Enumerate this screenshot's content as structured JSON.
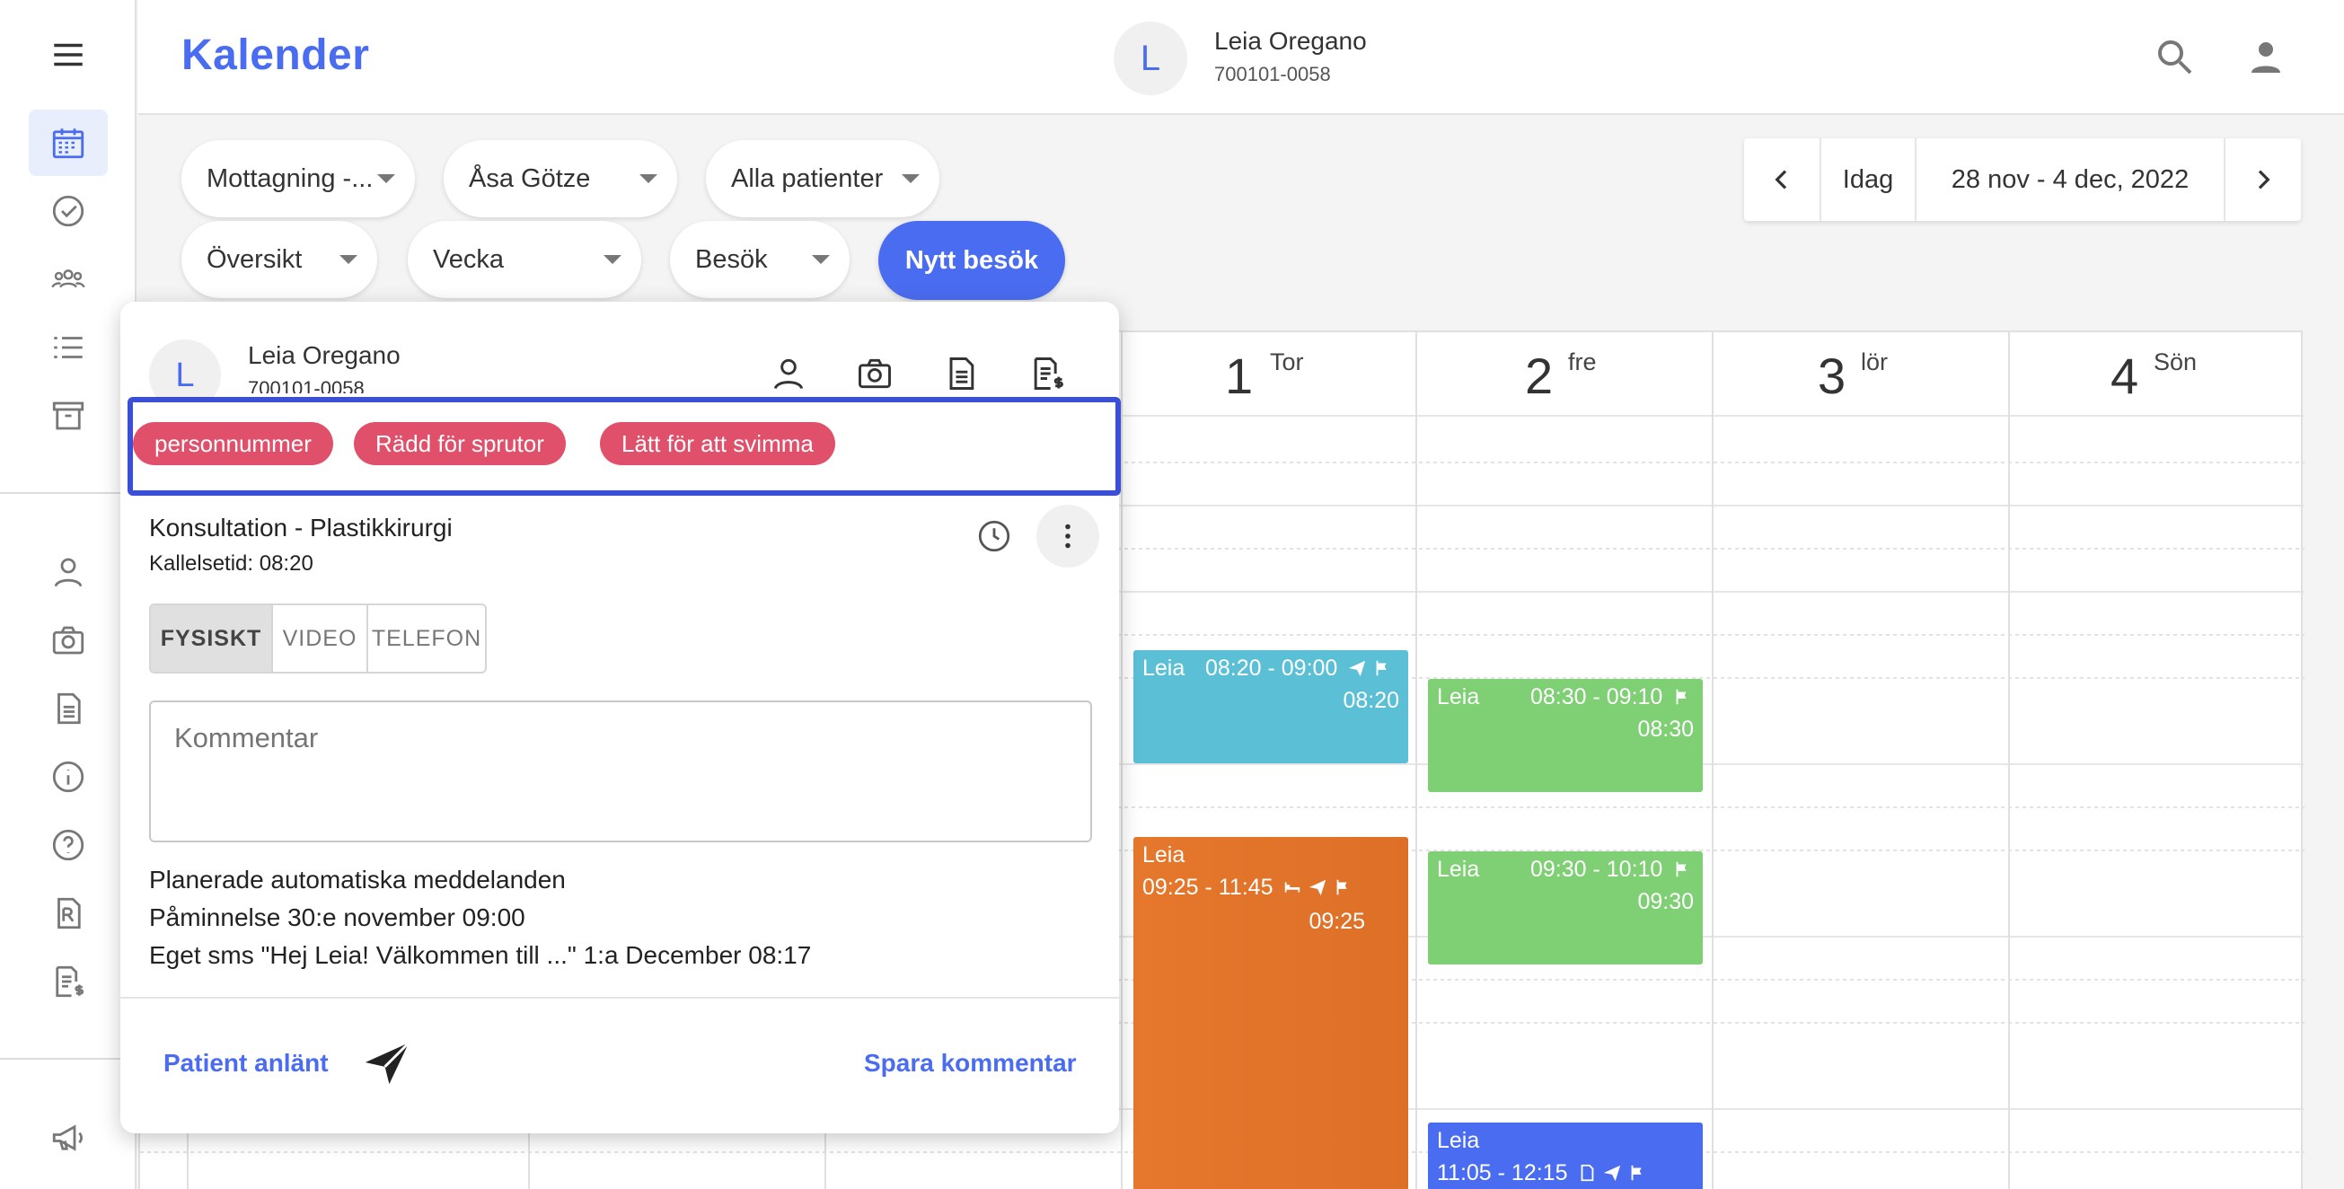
{
  "app": {
    "title": "Kalender"
  },
  "header": {
    "avatar_initial": "L",
    "patient_name": "Leia Oregano",
    "patient_id": "700101-0058"
  },
  "filters": {
    "row1": [
      "Mottagning -...",
      "Åsa Götze",
      "Alla patienter"
    ],
    "row2": [
      "Översikt",
      "Vecka",
      "Besök"
    ],
    "new_visit": "Nytt besök"
  },
  "date_nav": {
    "today": "Idag",
    "range": "28 nov - 4 dec, 2022"
  },
  "days": [
    {
      "num": "1",
      "name": "Tor"
    },
    {
      "num": "2",
      "name": "fre"
    },
    {
      "num": "3",
      "name": "lör"
    },
    {
      "num": "4",
      "name": "Sön"
    }
  ],
  "events": [
    {
      "who": "Leia",
      "time": "08:20 - 09:00",
      "call": "08:20",
      "color": "#5bbfd6"
    },
    {
      "who": "Leia",
      "time": "09:25 - 11:45",
      "call": "09:25",
      "color": "#e2732a"
    },
    {
      "who": "Leia",
      "time": "08:30 - 09:10",
      "call": "08:30",
      "color": "#7fcf74"
    },
    {
      "who": "Leia",
      "time": "09:30 - 10:10",
      "call": "09:30",
      "color": "#7fcf74"
    },
    {
      "who": "Leia",
      "time": "11:05 - 12:15",
      "call": "",
      "color": "#4a6cf0"
    }
  ],
  "popup": {
    "avatar_initial": "L",
    "name": "Leia Oregano",
    "id": "700101-0058",
    "tags": [
      "personnummer",
      "Rädd för sprutor",
      "Lätt för att svimma"
    ],
    "visit_title": "Konsultation - Plastikkirurgi",
    "call_time": "Kallelsetid: 08:20",
    "modes": [
      "FYSISKT",
      "VIDEO",
      "TELEFON"
    ],
    "active_mode": "FYSISKT",
    "comment_placeholder": "Kommentar",
    "messages_heading": "Planerade automatiska meddelanden",
    "messages": [
      "Påminnelse 30:e november 09:00",
      "Eget sms \"Hej Leia! Välkommen till ...\" 1:a December 08:17"
    ],
    "arrived_label": "Patient anlänt",
    "save_label": "Spara kommentar"
  },
  "colors": {
    "accent": "#4a6cf0",
    "tag": "#e0506a",
    "highlight_border": "#3a4fd6"
  }
}
